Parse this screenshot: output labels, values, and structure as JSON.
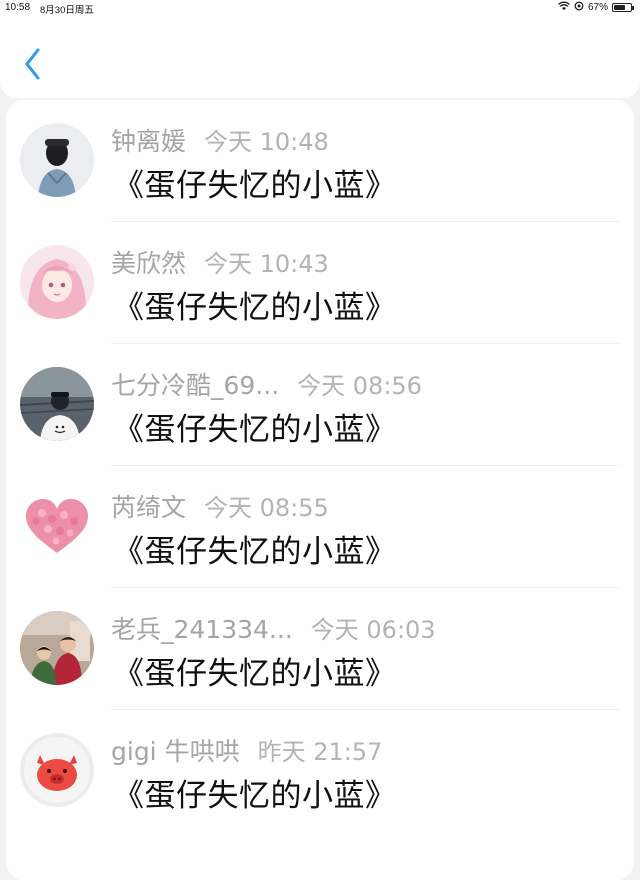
{
  "status_bar": {
    "time": "10:58",
    "date": "8月30日周五",
    "battery_text": "67%",
    "battery_level": 0.67
  },
  "nav": {
    "back_icon": "chevron-left-icon",
    "accent_color": "#2b9af3"
  },
  "comments": [
    {
      "name": "钟离媛",
      "time": "今天 10:48",
      "text": "《蛋仔失忆的小蓝》",
      "avatar": "person-back-avatar"
    },
    {
      "name": "美欣然",
      "time": "今天 10:43",
      "text": "《蛋仔失忆的小蓝》",
      "avatar": "anime-girl-avatar"
    },
    {
      "name": "七分冷酷_69...",
      "time": "今天 08:56",
      "text": "《蛋仔失忆的小蓝》",
      "avatar": "child-photo-avatar"
    },
    {
      "name": "芮绮文",
      "time": "今天 08:55",
      "text": "《蛋仔失忆的小蓝》",
      "avatar": "pink-heart-avatar"
    },
    {
      "name": "老兵_241334...",
      "time": "今天 06:03",
      "text": "《蛋仔失忆的小蓝》",
      "avatar": "family-photo-avatar"
    },
    {
      "name": "gigi 牛哄哄",
      "time": "昨天 21:57",
      "text": "《蛋仔失忆的小蓝》",
      "avatar": "pig-cartoon-avatar"
    }
  ]
}
